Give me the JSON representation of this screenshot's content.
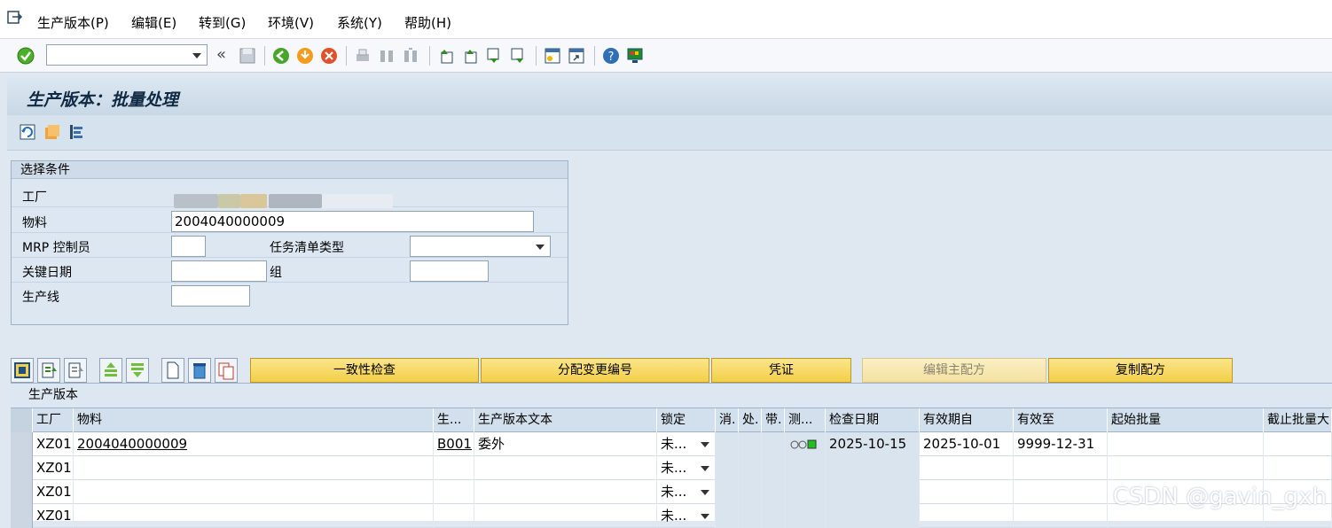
{
  "menubar": {
    "items": [
      "生产版本(P)",
      "编辑(E)",
      "转到(G)",
      "环境(V)",
      "系统(Y)",
      "帮助(H)"
    ]
  },
  "toolbar": {
    "command_value": ""
  },
  "title": "生产版本：批量处理",
  "selection": {
    "group_title": "选择条件",
    "plant_label": "工厂",
    "material_label": "物料",
    "material_value": "2004040000009",
    "mrp_label": "MRP 控制员",
    "mrp_value": "",
    "tasklist_type_label": "任务清单类型",
    "tasklist_type_value": "",
    "key_date_label": "关键日期",
    "key_date_value": "",
    "group_label": "组",
    "group_value": "",
    "prod_line_label": "生产线",
    "prod_line_value": ""
  },
  "buttons": {
    "consistency_check": "一致性检查",
    "assign_change_no": "分配变更编号",
    "voucher": "凭证",
    "edit_master_recipe": "编辑主配方",
    "copy_recipe": "复制配方"
  },
  "table": {
    "title": "生产版本",
    "headers": [
      "工厂",
      "物料",
      "生...",
      "生产版本文本",
      "锁定",
      "消.",
      "处.",
      "带.",
      "测...",
      "检查日期",
      "有效期自",
      "有效至",
      "起始批量",
      "截止批量大"
    ],
    "rows": [
      {
        "plant": "XZ01",
        "material": "2004040000009",
        "version": "B001",
        "text": "委外",
        "lock": "未...",
        "check_date": "2025-10-15",
        "valid_from": "2025-10-01",
        "valid_to": "9999-12-31"
      },
      {
        "plant": "XZ01",
        "material": "",
        "version": "",
        "text": "",
        "lock": "未...",
        "check_date": "",
        "valid_from": "",
        "valid_to": ""
      },
      {
        "plant": "XZ01",
        "material": "",
        "version": "",
        "text": "",
        "lock": "未...",
        "check_date": "",
        "valid_from": "",
        "valid_to": ""
      },
      {
        "plant": "XZ01",
        "material": "",
        "version": "",
        "text": "",
        "lock": "未...",
        "check_date": "",
        "valid_from": "",
        "valid_to": ""
      }
    ]
  },
  "watermark": "CSDN @gavin_gxh",
  "colors": {
    "accent_yellow": "#f3cf48",
    "header_blue": "#d2dfec"
  }
}
